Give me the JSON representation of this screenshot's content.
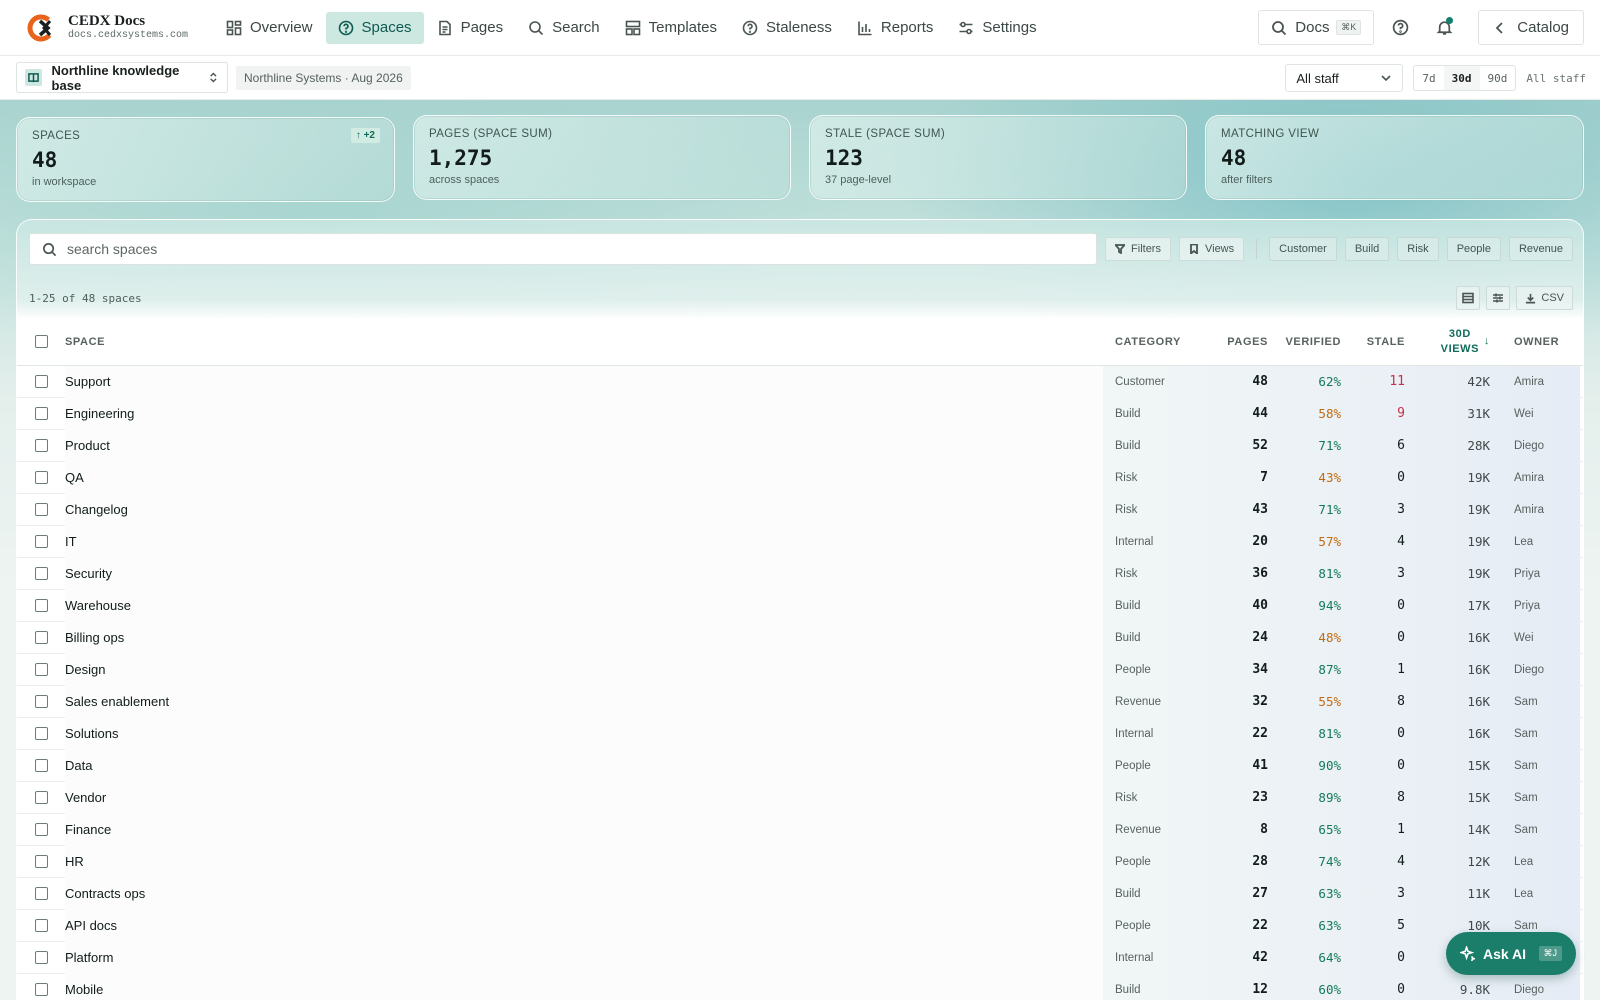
{
  "brand": {
    "name": "CEDX Docs",
    "url": "docs.cedxsystems.com"
  },
  "nav": [
    {
      "label": "Overview",
      "icon": "grid-icon",
      "active": false
    },
    {
      "label": "Spaces",
      "icon": "help-circle-icon",
      "active": true
    },
    {
      "label": "Pages",
      "icon": "page-icon",
      "active": false
    },
    {
      "label": "Search",
      "icon": "search-icon",
      "active": false
    },
    {
      "label": "Templates",
      "icon": "template-icon",
      "active": false
    },
    {
      "label": "Staleness",
      "icon": "help-circle-icon",
      "active": false
    },
    {
      "label": "Reports",
      "icon": "bar-chart-icon",
      "active": false
    },
    {
      "label": "Settings",
      "icon": "sliders-icon",
      "active": false
    }
  ],
  "topright": {
    "search_label": "Docs",
    "search_kbd": "⌘K",
    "catalog_label": "Catalog"
  },
  "subbar": {
    "kb_label": "Northline knowledge base",
    "org_label": "Northline Systems · Aug 2026",
    "staff_select": "All staff",
    "ranges": [
      {
        "label": "7d",
        "active": false
      },
      {
        "label": "30d",
        "active": true
      },
      {
        "label": "90d",
        "active": false
      }
    ],
    "all_staff_label": "All staff"
  },
  "kpis": [
    {
      "label": "SPACES",
      "value": "48",
      "sub": "in workspace",
      "badge": "↑ +2"
    },
    {
      "label": "PAGES (SPACE SUM)",
      "value": "1,275",
      "sub": "across spaces"
    },
    {
      "label": "STALE (SPACE SUM)",
      "value": "123",
      "sub": "37 page-level"
    },
    {
      "label": "MATCHING VIEW",
      "value": "48",
      "sub": "after filters"
    }
  ],
  "toolbar": {
    "search_placeholder": "search spaces",
    "filters_label": "Filters",
    "views_label": "Views",
    "chips": [
      "Customer",
      "Build",
      "Risk",
      "People",
      "Revenue"
    ],
    "count_text": "1-25 of 48 spaces",
    "csv_label": "CSV"
  },
  "table": {
    "headers": {
      "space": "SPACE",
      "category": "CATEGORY",
      "pages": "PAGES",
      "verified": "VERIFIED",
      "stale": "STALE",
      "views": "30D VIEWS",
      "sort_arrow": "↓",
      "owner": "OWNER"
    },
    "rows": [
      {
        "space": "Support",
        "category": "Customer",
        "pages": "48",
        "verified": "62%",
        "verified_status": "good",
        "stale": "11",
        "stale_status": "bad",
        "views": "42K",
        "owner": "Amira"
      },
      {
        "space": "Engineering",
        "category": "Build",
        "pages": "44",
        "verified": "58%",
        "verified_status": "warn",
        "stale": "9",
        "stale_status": "bad",
        "views": "31K",
        "owner": "Wei"
      },
      {
        "space": "Product",
        "category": "Build",
        "pages": "52",
        "verified": "71%",
        "verified_status": "good",
        "stale": "6",
        "stale_status": "neutral",
        "views": "28K",
        "owner": "Diego"
      },
      {
        "space": "QA",
        "category": "Risk",
        "pages": "7",
        "verified": "43%",
        "verified_status": "warn",
        "stale": "0",
        "stale_status": "neutral",
        "views": "19K",
        "owner": "Amira"
      },
      {
        "space": "Changelog",
        "category": "Risk",
        "pages": "43",
        "verified": "71%",
        "verified_status": "good",
        "stale": "3",
        "stale_status": "neutral",
        "views": "19K",
        "owner": "Amira"
      },
      {
        "space": "IT",
        "category": "Internal",
        "pages": "20",
        "verified": "57%",
        "verified_status": "warn",
        "stale": "4",
        "stale_status": "neutral",
        "views": "19K",
        "owner": "Lea"
      },
      {
        "space": "Security",
        "category": "Risk",
        "pages": "36",
        "verified": "81%",
        "verified_status": "good",
        "stale": "3",
        "stale_status": "neutral",
        "views": "19K",
        "owner": "Priya"
      },
      {
        "space": "Warehouse",
        "category": "Build",
        "pages": "40",
        "verified": "94%",
        "verified_status": "good",
        "stale": "0",
        "stale_status": "neutral",
        "views": "17K",
        "owner": "Priya"
      },
      {
        "space": "Billing ops",
        "category": "Build",
        "pages": "24",
        "verified": "48%",
        "verified_status": "warn",
        "stale": "0",
        "stale_status": "neutral",
        "views": "16K",
        "owner": "Wei"
      },
      {
        "space": "Design",
        "category": "People",
        "pages": "34",
        "verified": "87%",
        "verified_status": "good",
        "stale": "1",
        "stale_status": "neutral",
        "views": "16K",
        "owner": "Diego"
      },
      {
        "space": "Sales enablement",
        "category": "Revenue",
        "pages": "32",
        "verified": "55%",
        "verified_status": "warn",
        "stale": "8",
        "stale_status": "neutral",
        "views": "16K",
        "owner": "Sam"
      },
      {
        "space": "Solutions",
        "category": "Internal",
        "pages": "22",
        "verified": "81%",
        "verified_status": "good",
        "stale": "0",
        "stale_status": "neutral",
        "views": "16K",
        "owner": "Sam"
      },
      {
        "space": "Data",
        "category": "People",
        "pages": "41",
        "verified": "90%",
        "verified_status": "good",
        "stale": "0",
        "stale_status": "neutral",
        "views": "15K",
        "owner": "Sam"
      },
      {
        "space": "Vendor",
        "category": "Risk",
        "pages": "23",
        "verified": "89%",
        "verified_status": "good",
        "stale": "8",
        "stale_status": "neutral",
        "views": "15K",
        "owner": "Sam"
      },
      {
        "space": "Finance",
        "category": "Revenue",
        "pages": "8",
        "verified": "65%",
        "verified_status": "good",
        "stale": "1",
        "stale_status": "neutral",
        "views": "14K",
        "owner": "Sam"
      },
      {
        "space": "HR",
        "category": "People",
        "pages": "28",
        "verified": "74%",
        "verified_status": "good",
        "stale": "4",
        "stale_status": "neutral",
        "views": "12K",
        "owner": "Lea"
      },
      {
        "space": "Contracts ops",
        "category": "Build",
        "pages": "27",
        "verified": "63%",
        "verified_status": "good",
        "stale": "3",
        "stale_status": "neutral",
        "views": "11K",
        "owner": "Lea"
      },
      {
        "space": "API docs",
        "category": "People",
        "pages": "22",
        "verified": "63%",
        "verified_status": "good",
        "stale": "5",
        "stale_status": "neutral",
        "views": "10K",
        "owner": "Sam"
      },
      {
        "space": "Platform",
        "category": "Internal",
        "pages": "42",
        "verified": "64%",
        "verified_status": "good",
        "stale": "0",
        "stale_status": "neutral",
        "views": "",
        "owner": ""
      },
      {
        "space": "Mobile",
        "category": "Build",
        "pages": "12",
        "verified": "60%",
        "verified_status": "good",
        "stale": "0",
        "stale_status": "neutral",
        "views": "9.8K",
        "owner": "Diego"
      }
    ]
  },
  "ask_ai": {
    "label": "Ask AI",
    "kbd": "⌘J"
  },
  "colors": {
    "accent": "#1b7e6b",
    "good": "#137a58",
    "warn": "#c26b11",
    "bad": "#c7304a"
  }
}
